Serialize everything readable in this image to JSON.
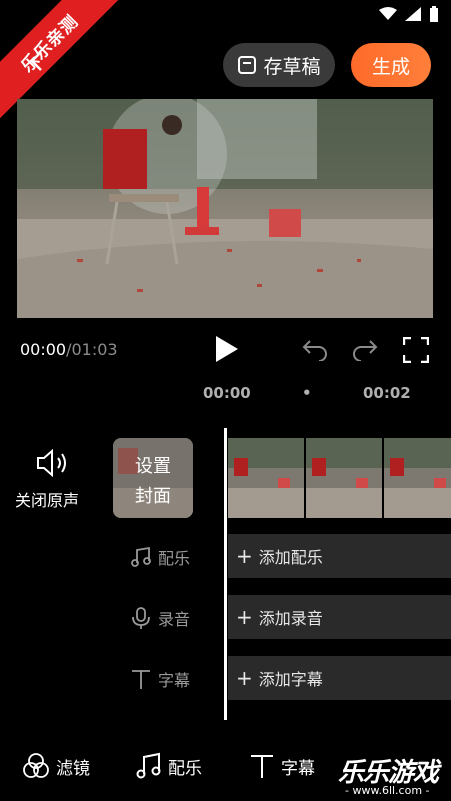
{
  "ribbon": {
    "text": "乐乐亲测"
  },
  "header": {
    "draft_label": "存草稿",
    "generate_label": "生成"
  },
  "player": {
    "current_time": "00:00",
    "total_time": "/01:03"
  },
  "timeline": {
    "marker_start": "00:00",
    "marker_dot": "•",
    "marker_end": "00:02"
  },
  "side": {
    "mute_label": "关闭原声",
    "cover_line1": "设置",
    "cover_line2": "封面"
  },
  "tracks": [
    {
      "icon": "music-icon",
      "label": "配乐",
      "add_label": "添加配乐"
    },
    {
      "icon": "mic-icon",
      "label": "录音",
      "add_label": "添加录音"
    },
    {
      "icon": "text-icon",
      "label": "字幕",
      "add_label": "添加字幕"
    }
  ],
  "bottom_bar": [
    {
      "icon": "filter-icon",
      "label": "滤镜"
    },
    {
      "icon": "music-icon",
      "label": "配乐"
    },
    {
      "icon": "text-icon",
      "label": "字幕"
    }
  ],
  "watermark": {
    "brand": "乐乐游戏",
    "url": "- www.6ll.com -"
  },
  "colors": {
    "accent": "#ff6a2a",
    "ribbon": "#e02020",
    "track_bg": "#2a2a2a"
  }
}
